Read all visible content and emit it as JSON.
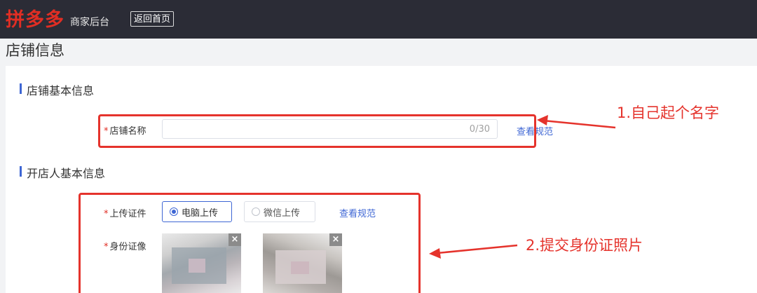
{
  "header": {
    "logo_text": "拼多多",
    "subtitle": "商家后台",
    "home_button": "返回首页"
  },
  "page_title": "店铺信息",
  "shop_section": {
    "title": "店铺基本信息",
    "name_field": {
      "required_mark": "*",
      "label": "店铺名称",
      "value": "",
      "counter": "0/30"
    },
    "spec_link": "查看规范"
  },
  "owner_section": {
    "title": "开店人基本信息",
    "upload_cert": {
      "required_mark": "*",
      "label": "上传证件",
      "options": [
        {
          "label": "电脑上传",
          "selected": true
        },
        {
          "label": "微信上传",
          "selected": false
        }
      ],
      "spec_link": "查看规范"
    },
    "id_photo": {
      "required_mark": "*",
      "label": "身份证像",
      "close_symbol": "×"
    }
  },
  "annotations": [
    {
      "text": "1.自己起个名字"
    },
    {
      "text": "2.提交身份证照片"
    }
  ],
  "colors": {
    "topbar_bg": "#2b2c36",
    "brand_red": "#e02e24",
    "accent_blue": "#3e66d4",
    "annotation_red": "#e5332c"
  }
}
